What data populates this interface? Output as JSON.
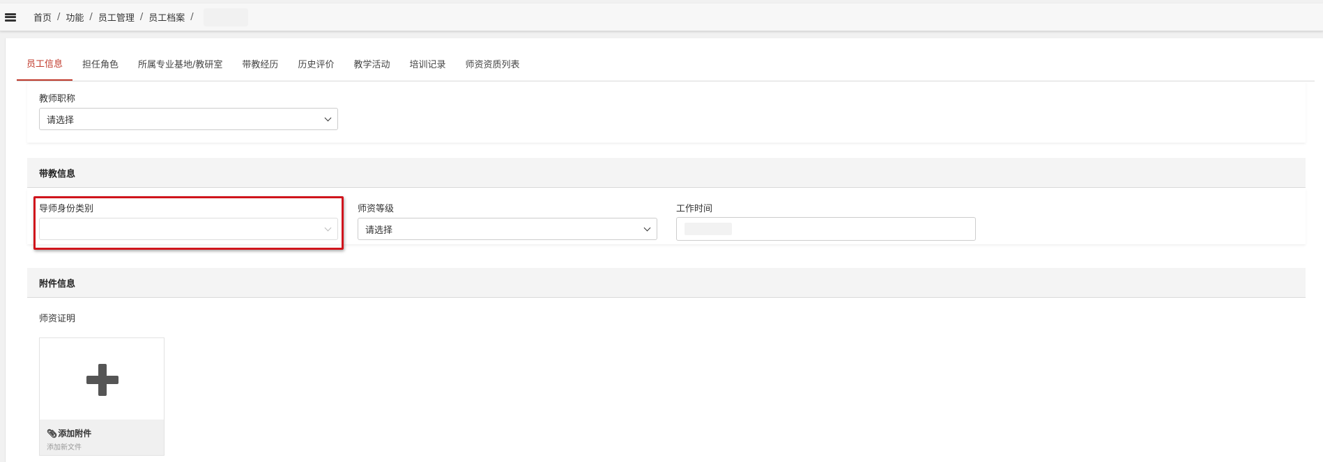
{
  "breadcrumb": {
    "items": [
      "首页",
      "功能",
      "员工管理",
      "员工档案"
    ],
    "separator": "/"
  },
  "tabs": [
    {
      "label": "员工信息",
      "active": true
    },
    {
      "label": "担任角色",
      "active": false
    },
    {
      "label": "所属专业基地/教研室",
      "active": false
    },
    {
      "label": "带教经历",
      "active": false
    },
    {
      "label": "历史评价",
      "active": false
    },
    {
      "label": "教学活动",
      "active": false
    },
    {
      "label": "培训记录",
      "active": false
    },
    {
      "label": "师资资质列表",
      "active": false
    }
  ],
  "teacher_title": {
    "label": "教师职称",
    "value": "请选择"
  },
  "teaching_section": {
    "header": "带教信息",
    "mentor_type": {
      "label": "导师身份类别",
      "value": ""
    },
    "teacher_level": {
      "label": "师资等级",
      "value": "请选择"
    },
    "work_time": {
      "label": "工作时间",
      "value": ""
    }
  },
  "attachment_section": {
    "header": "附件信息",
    "cert_label": "师资证明",
    "upload": {
      "title": "添加附件",
      "subtitle": "添加新文件"
    }
  },
  "colors": {
    "accent": "#c0392b",
    "highlight": "#d0141c",
    "icon": "#555555"
  },
  "icons": {
    "menu": "hamburger-icon",
    "upload": "plus-icon",
    "attach": "paperclip-icon",
    "dropdown": "chevron-down-icon"
  }
}
